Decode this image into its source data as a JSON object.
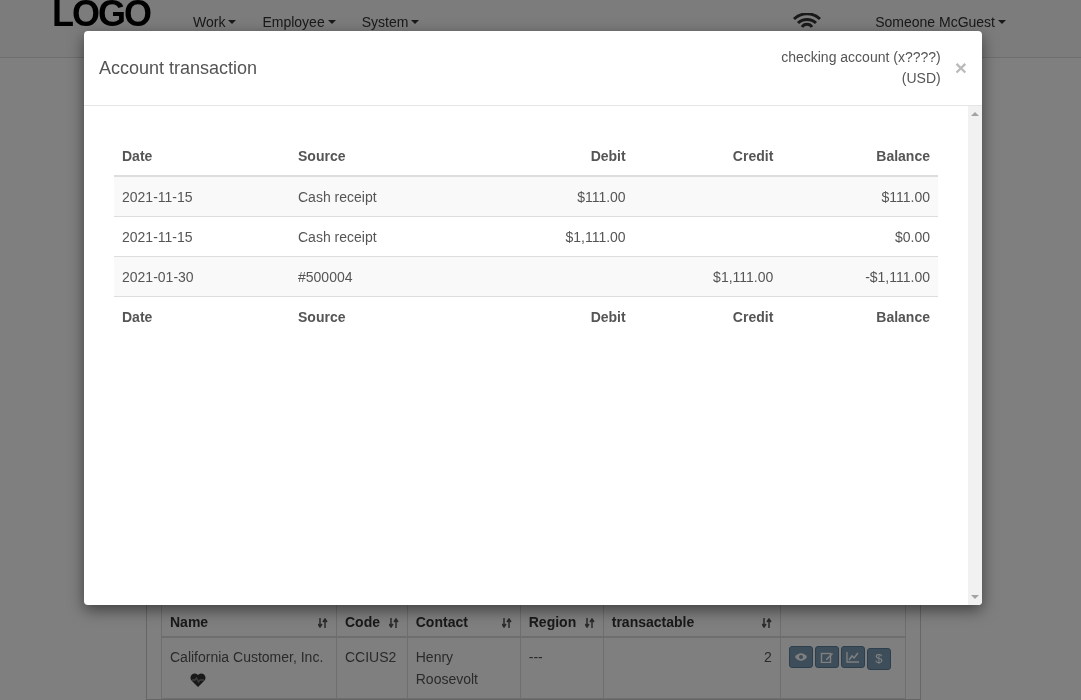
{
  "navbar": {
    "logo": "LOGO",
    "menus": [
      {
        "label": "Work"
      },
      {
        "label": "Employee"
      },
      {
        "label": "System"
      }
    ],
    "user": "Someone McGuest"
  },
  "background_table": {
    "columns": [
      {
        "label": "Name",
        "sortable": true
      },
      {
        "label": "Code",
        "sortable": true
      },
      {
        "label": "Contact",
        "sortable": true
      },
      {
        "label": "Region",
        "sortable": true
      },
      {
        "label": "transactable",
        "sortable": true
      },
      {
        "sortable": false
      }
    ],
    "rows": [
      {
        "name": "California Customer, Inc.",
        "code": "CCIUS2",
        "contact": "Henry Roosevolt",
        "region": "---",
        "transactable": "2",
        "actions": [
          {
            "kind": "view"
          },
          {
            "kind": "edit"
          },
          {
            "kind": "chart"
          },
          {
            "kind": "text",
            "label": "$"
          }
        ]
      }
    ]
  },
  "modal": {
    "title": "Account transaction",
    "account": "checking account (x????)",
    "currency": "(USD)",
    "close": "×",
    "columns": [
      "Date",
      "Source",
      "Debit",
      "Credit",
      "Balance"
    ],
    "rows": [
      {
        "date": "2021-11-15",
        "source": "Cash receipt",
        "debit": "$111.00",
        "credit": "",
        "balance": "$111.00"
      },
      {
        "date": "2021-11-15",
        "source": "Cash receipt",
        "debit": "$1,111.00",
        "credit": "",
        "balance": "$0.00"
      },
      {
        "date": "2021-01-30",
        "source": "#500004",
        "debit": "",
        "credit": "$1,111.00",
        "balance": "-$1,111.00"
      }
    ],
    "footer_columns": [
      "Date",
      "Source",
      "Debit",
      "Credit",
      "Balance"
    ]
  }
}
